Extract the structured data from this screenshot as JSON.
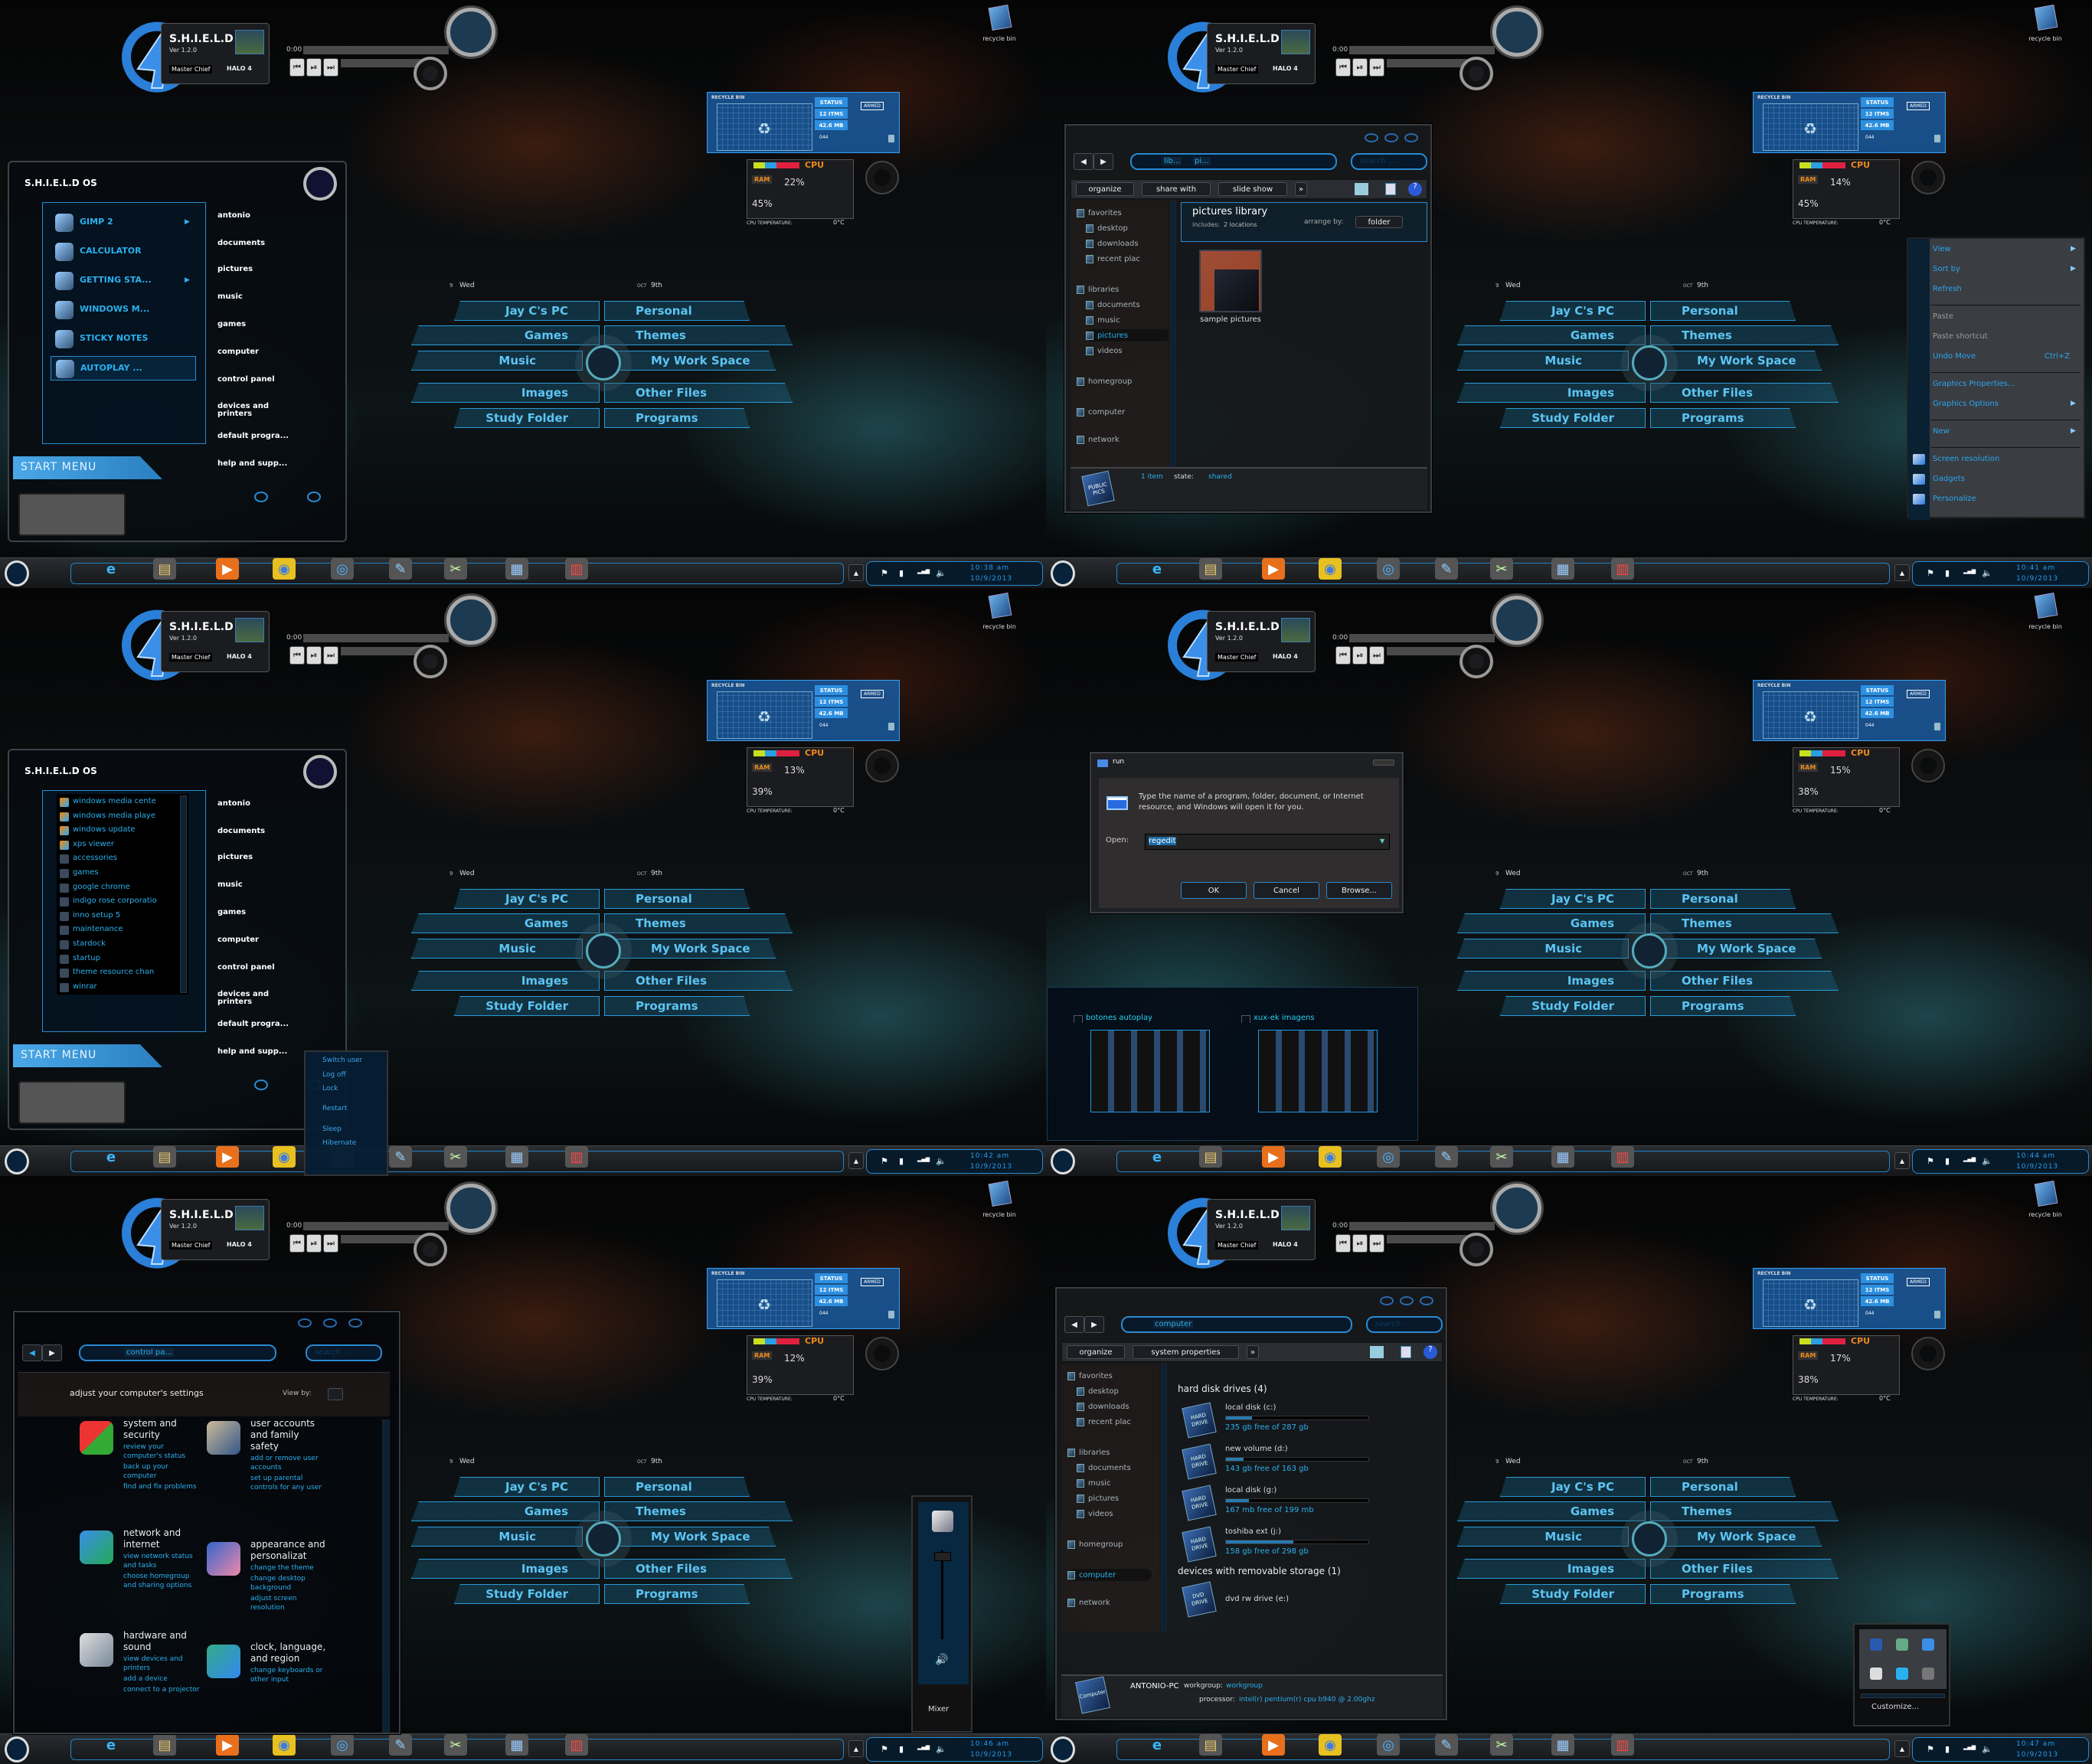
{
  "colors": {
    "accent": "#1e9be0",
    "text_cyan": "#2ab0ee",
    "panel_dark": "#0b1118",
    "menu_grey": "#3a3d42",
    "cpu_orange": "#f08a1c"
  },
  "desktop": {
    "logo": {
      "title": "S.H.I.E.L.D OS",
      "version": "Ver 1.2.0",
      "user": "Master Chief",
      "game": "HALO 4"
    },
    "player": {
      "time": "0:00",
      "buttons": [
        "previous",
        "play-pause",
        "next"
      ]
    },
    "recycle_bin": "recycle bin",
    "ring_menu": {
      "day_num": "9",
      "day": "Wed",
      "month": "OCT",
      "date": "9th",
      "left": [
        "Jay C's PC",
        "Games",
        "Music",
        "Images",
        "Study Folder"
      ],
      "right": [
        "Personal",
        "Themes",
        "My Work Space",
        "Other Files",
        "Programs"
      ]
    },
    "gadget": {
      "title": "RECYCLE BIN",
      "status": "STATUS",
      "items": "12 ITMS",
      "size": "42.6 MB",
      "code": "044",
      "armed": "ARMED",
      "ram_label": "RAM",
      "cpu_label": "CPU",
      "temp_label": "CPU TEMPERATURE:",
      "temp": "0°C"
    },
    "tray": {
      "date": "10/9/2013"
    },
    "taskbar_icons": [
      "internet-explorer",
      "windows-explorer",
      "windows-media-player",
      "google-chrome",
      "autoplay",
      "notepad",
      "gimp",
      "remote-desktop",
      "control-panel"
    ]
  },
  "screens": [
    {
      "clock": "10:38 am",
      "cpu": "22%",
      "ram": "45%"
    },
    {
      "clock": "10:41 am",
      "cpu": "14%",
      "ram": "45%"
    },
    {
      "clock": "10:42 am",
      "cpu": "13%",
      "ram": "39%"
    },
    {
      "clock": "10:44 am",
      "cpu": "15%",
      "ram": "38%"
    },
    {
      "clock": "10:46 am",
      "cpu": "12%",
      "ram": "39%"
    },
    {
      "clock": "10:47 am",
      "cpu": "17%",
      "ram": "38%"
    }
  ],
  "start_menu": {
    "title": "S.H.I.E.L.D OS",
    "footer": "START MENU",
    "pinned": [
      {
        "label": "GIMP 2",
        "arrow": true,
        "icon": "gimp"
      },
      {
        "label": "CALCULATOR",
        "icon": "calculator"
      },
      {
        "label": "GETTING STA...",
        "arrow": true,
        "icon": "getting-started"
      },
      {
        "label": "WINDOWS M...",
        "icon": "windows-media-center"
      },
      {
        "label": "STICKY NOTES",
        "icon": "sticky-notes"
      },
      {
        "label": "AUTOPLAY ...",
        "icon": "autoplay",
        "selected": true
      }
    ],
    "places": [
      "antonio",
      "documents",
      "pictures",
      "music",
      "games",
      "computer",
      "control panel",
      "devices and printers",
      "default progra...",
      "help and supp..."
    ],
    "all_programs": [
      "windows media cente",
      "windows media playe",
      "windows update",
      "xps viewer",
      "accessories",
      "games",
      "google chrome",
      "indigo rose corporatio",
      "inno setup 5",
      "maintenance",
      "stardock",
      "startup",
      "theme resource chan",
      "winrar"
    ],
    "power_menu": [
      "Switch user",
      "Log off",
      "Lock",
      "Restart",
      "Sleep",
      "Hibernate"
    ]
  },
  "pictures_explorer": {
    "breadcrumb": [
      "lib...",
      "pi..."
    ],
    "search_placeholder": "search ...",
    "toolbar": [
      "organize",
      "share with",
      "slide show",
      "»"
    ],
    "nav": [
      {
        "label": "favorites",
        "level": 0
      },
      {
        "label": "desktop",
        "level": 1
      },
      {
        "label": "downloads",
        "level": 1
      },
      {
        "label": "recent plac",
        "level": 1
      },
      {
        "label": "libraries",
        "level": 0
      },
      {
        "label": "documents",
        "level": 1
      },
      {
        "label": "music",
        "level": 1
      },
      {
        "label": "pictures",
        "level": 1,
        "selected": true
      },
      {
        "label": "videos",
        "level": 1
      },
      {
        "label": "homegroup",
        "level": 0
      },
      {
        "label": "computer",
        "level": 0
      },
      {
        "label": "network",
        "level": 0
      }
    ],
    "header": "pictures library",
    "includes_label": "includes:",
    "includes_value": "2 locations",
    "arrange_label": "arrange by:",
    "arrange_value": "folder",
    "items": [
      "sample pictures"
    ],
    "status": {
      "count": "1 item",
      "state_label": "state:",
      "state_value": "shared",
      "badge": "PUBLIC PICS"
    }
  },
  "context_menu": [
    {
      "label": "View",
      "arrow": true
    },
    {
      "label": "Sort by",
      "arrow": true
    },
    {
      "label": "Refresh"
    },
    {
      "sep": true
    },
    {
      "label": "Paste",
      "disabled": true
    },
    {
      "label": "Paste shortcut",
      "disabled": true
    },
    {
      "label": "Undo Move",
      "shortcut": "Ctrl+Z"
    },
    {
      "sep": true
    },
    {
      "label": "Graphics Properties..."
    },
    {
      "label": "Graphics Options",
      "arrow": true
    },
    {
      "sep": true
    },
    {
      "label": "New",
      "arrow": true
    },
    {
      "sep": true
    },
    {
      "label": "Screen resolution",
      "icon": "screen-resolution"
    },
    {
      "label": "Gadgets",
      "icon": "gadgets"
    },
    {
      "label": "Personalize",
      "icon": "personalize"
    }
  ],
  "run_dialog": {
    "title": "run",
    "description": "Type the name of a program, folder, document, or Internet resource, and Windows will open it for you.",
    "open_label": "Open:",
    "value": "regedit",
    "buttons": [
      "OK",
      "Cancel",
      "Browse..."
    ]
  },
  "thumbnails": [
    "botones autoplay",
    "xux-ek imagens"
  ],
  "control_panel": {
    "breadcrumb": "control pa...",
    "search_placeholder": "search ...",
    "title": "adjust your computer's settings",
    "view_by_label": "View by:",
    "categories": [
      {
        "title": "system and security",
        "icon": "shield",
        "links": [
          "review your computer's status",
          "back up your computer",
          "find and fix problems"
        ]
      },
      {
        "title": "user accounts and family safety",
        "icon": "users",
        "links": [
          "add or remove user accounts",
          "set up parental controls for any user"
        ]
      },
      {
        "title": "network and internet",
        "icon": "network",
        "links": [
          "view network status and tasks",
          "choose homegroup and sharing options"
        ]
      },
      {
        "title": "appearance and personalizat",
        "icon": "appearance",
        "links": [
          "change the theme",
          "change desktop background",
          "adjust screen resolution"
        ]
      },
      {
        "title": "hardware and sound",
        "icon": "hardware",
        "links": [
          "view devices and printers",
          "add a device",
          "connect to a projector"
        ]
      },
      {
        "title": "clock, language, and region",
        "icon": "clock-globe",
        "links": [
          "change keyboards or other input"
        ]
      }
    ]
  },
  "mixer": {
    "label": "Mixer",
    "volume_percent": 95
  },
  "computer_explorer": {
    "breadcrumb": "computer",
    "search_placeholder": "search ...",
    "toolbar": [
      "organize",
      "system properties",
      "»"
    ],
    "nav": [
      {
        "label": "favorites",
        "level": 0
      },
      {
        "label": "desktop",
        "level": 1
      },
      {
        "label": "downloads",
        "level": 1
      },
      {
        "label": "recent plac",
        "level": 1
      },
      {
        "label": "libraries",
        "level": 0
      },
      {
        "label": "documents",
        "level": 1
      },
      {
        "label": "music",
        "level": 1
      },
      {
        "label": "pictures",
        "level": 1
      },
      {
        "label": "videos",
        "level": 1
      },
      {
        "label": "homegroup",
        "level": 0
      },
      {
        "label": "computer",
        "level": 0,
        "selected": true
      },
      {
        "label": "network",
        "level": 0
      }
    ],
    "hdd_header": "hard disk drives (4)",
    "drives": [
      {
        "name": "local disk (c:)",
        "free": "235 gb free of 287 gb",
        "used_fraction": 0.18
      },
      {
        "name": "new volume (d:)",
        "free": "143 gb free of 163 gb",
        "used_fraction": 0.12
      },
      {
        "name": "local disk (g:)",
        "free": "167 mb free of 199 mb",
        "used_fraction": 0.16
      },
      {
        "name": "toshiba ext (j:)",
        "free": "158 gb free of 298 gb",
        "used_fraction": 0.47
      }
    ],
    "drive_badge": "HARD DRIVE",
    "removable_header": "devices with removable storage (1)",
    "removable": [
      {
        "name": "dvd rw drive (e:)",
        "badge": "DVD DRIVE"
      }
    ],
    "status": {
      "pc": "ANTONIO-PC",
      "workgroup_label": "workgroup:",
      "workgroup": "workgroup",
      "processor_label": "processor:",
      "processor": "intel(r) pentium(r) cpu b940 @ 2.00ghz",
      "badge": "Computer"
    }
  },
  "tray_popup": {
    "customize": "Customize...",
    "icons": [
      "display",
      "usb-safe-remove",
      "windows-update",
      "droplet",
      "security-shield",
      "full-play"
    ]
  }
}
